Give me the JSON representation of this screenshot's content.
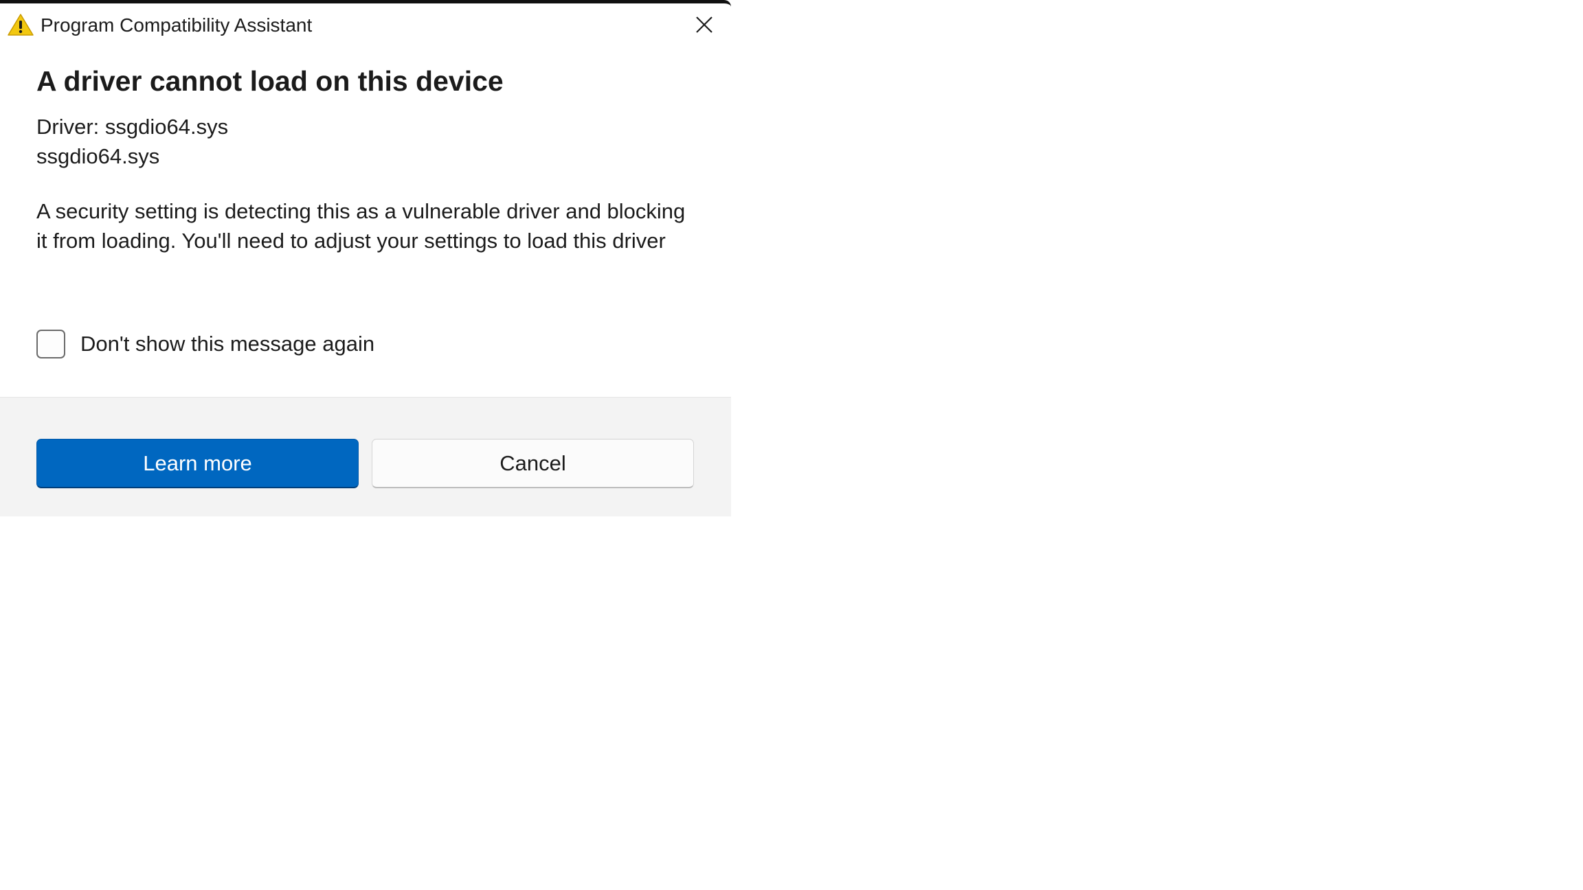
{
  "window": {
    "title": "Program Compatibility Assistant",
    "icon": "warning-triangle-icon",
    "close_icon": "close-icon"
  },
  "dialog": {
    "heading": "A driver cannot load on this device",
    "driver_label": "Driver: ssgdio64.sys",
    "driver_file": "ssgdio64.sys",
    "message": "A security setting is detecting this as a vulnerable driver and blocking it from loading. You'll need to adjust your settings to load this driver",
    "checkbox_label": "Don't show this message again",
    "checkbox_checked": false
  },
  "buttons": {
    "learn_more": "Learn more",
    "cancel": "Cancel"
  },
  "colors": {
    "accent": "#0067c0",
    "warning": "#f2c811",
    "footer_bg": "#f3f3f3"
  }
}
